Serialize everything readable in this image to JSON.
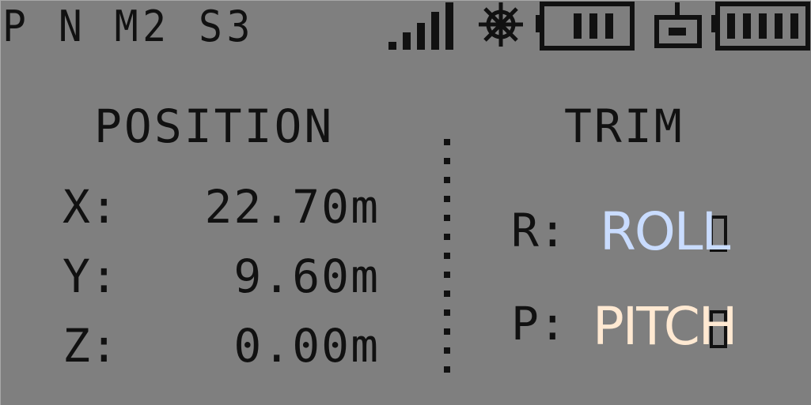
{
  "status_bar": {
    "mode_text": "P N M2 S3",
    "icons": [
      "signal-icon",
      "gps-icon",
      "transmitter-battery-icon",
      "drone-icon",
      "drone-battery-icon"
    ]
  },
  "position": {
    "title": "POSITION",
    "rows": [
      {
        "label": "X:",
        "value": "22.70m"
      },
      {
        "label": "Y:",
        "value": "9.60m"
      },
      {
        "label": "Z:",
        "value": "0.00m"
      }
    ]
  },
  "trim": {
    "title": "TRIM",
    "rows": [
      {
        "label": "R:",
        "overlay": "ROLL"
      },
      {
        "label": "P:",
        "overlay": "PITCH"
      }
    ]
  },
  "colors": {
    "background": "#7f7f7f",
    "lcd_text": "#111111",
    "roll_overlay": "#c9dcff",
    "pitch_overlay": "#ffe9d2"
  }
}
